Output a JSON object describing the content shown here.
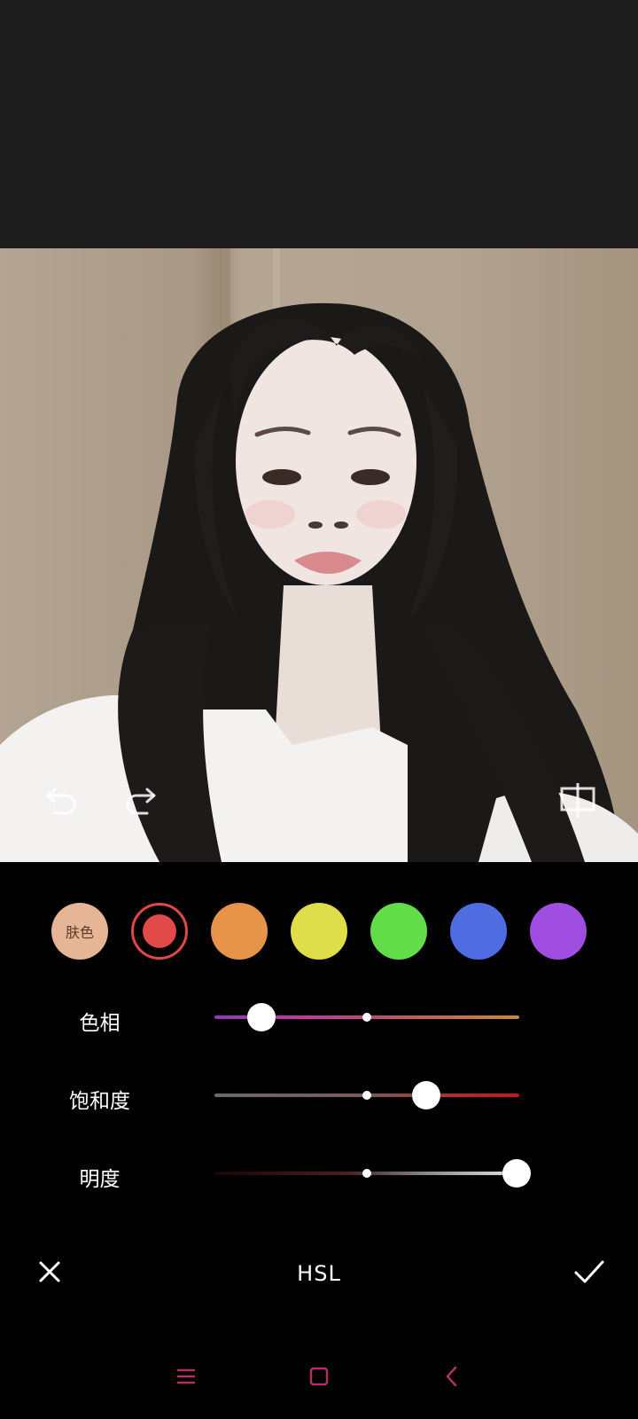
{
  "editor": {
    "title": "HSL",
    "cancel_icon": "close-icon",
    "confirm_icon": "check-icon"
  },
  "photo_toolbar": {
    "undo_icon": "undo-icon",
    "redo_icon": "redo-icon",
    "compare_icon": "compare-icon"
  },
  "color_swatches": [
    {
      "label": "肤色",
      "color": "#e6b595",
      "selected": false
    },
    {
      "label": "",
      "color": "#e24a4a",
      "selected": true
    },
    {
      "label": "",
      "color": "#e6944a",
      "selected": false
    },
    {
      "label": "",
      "color": "#dedd4a",
      "selected": false
    },
    {
      "label": "",
      "color": "#62dc48",
      "selected": false
    },
    {
      "label": "",
      "color": "#4f6de0",
      "selected": false
    },
    {
      "label": "",
      "color": "#a04ee0",
      "selected": false
    }
  ],
  "sliders": {
    "hue": {
      "label": "色相",
      "value": -0.69
    },
    "saturation": {
      "label": "饱和度",
      "value": 0.39
    },
    "lightness": {
      "label": "明度",
      "value": 0.98
    }
  },
  "nav": {
    "menu_icon": "menu-icon",
    "home_icon": "home-icon",
    "back_icon": "back-icon"
  },
  "colors": {
    "accent": "#e04848",
    "nav_icon": "#b0306a"
  }
}
